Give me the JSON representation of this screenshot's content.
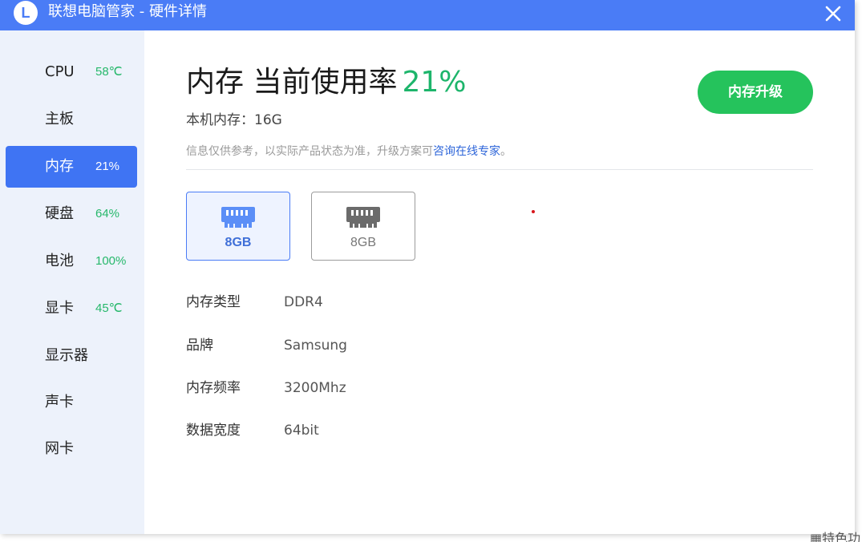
{
  "window": {
    "logo_letter": "L",
    "title": "联想电脑管家 - 硬件详情"
  },
  "sidebar": {
    "items": [
      {
        "label": "CPU",
        "value": "58℃",
        "active": false
      },
      {
        "label": "主板",
        "value": "",
        "active": false
      },
      {
        "label": "内存",
        "value": "21%",
        "active": true
      },
      {
        "label": "硬盘",
        "value": "64%",
        "active": false
      },
      {
        "label": "电池",
        "value": "100%",
        "active": false
      },
      {
        "label": "显卡",
        "value": "45℃",
        "active": false
      },
      {
        "label": "显示器",
        "value": "",
        "active": false
      },
      {
        "label": "声卡",
        "value": "",
        "active": false
      },
      {
        "label": "网卡",
        "value": "",
        "active": false
      }
    ]
  },
  "main": {
    "heading": "内存 当前使用率",
    "usage": "21%",
    "upgrade_label": "内存升级",
    "capacity": "本机内存：16G",
    "notice_text": "信息仅供参考，以实际产品状态为准，升级方案可",
    "notice_link": "咨询在线专家",
    "notice_end": "。",
    "modules": [
      {
        "label": "8GB",
        "active": true,
        "icon": "memory-stick-icon"
      },
      {
        "label": "8GB",
        "active": false,
        "icon": "memory-stick-icon"
      }
    ],
    "specs": [
      {
        "key": "内存类型",
        "value": "DDR4"
      },
      {
        "key": "品牌",
        "value": "Samsung"
      },
      {
        "key": "内存频率",
        "value": "3200Mhz"
      },
      {
        "key": "数据宽度",
        "value": "64bit"
      }
    ]
  },
  "colors": {
    "titlebar": "#4a7cf6",
    "sidebar_bg": "#edf2fb",
    "active_nav": "#3f74f3",
    "status_green": "#27b86b",
    "upgrade_button": "#25c35c",
    "link": "#2d65d9",
    "memory_icon_active": "#5b8ef7",
    "memory_icon_inactive": "#6b6b6b"
  },
  "taskbar_hint": "特色功"
}
